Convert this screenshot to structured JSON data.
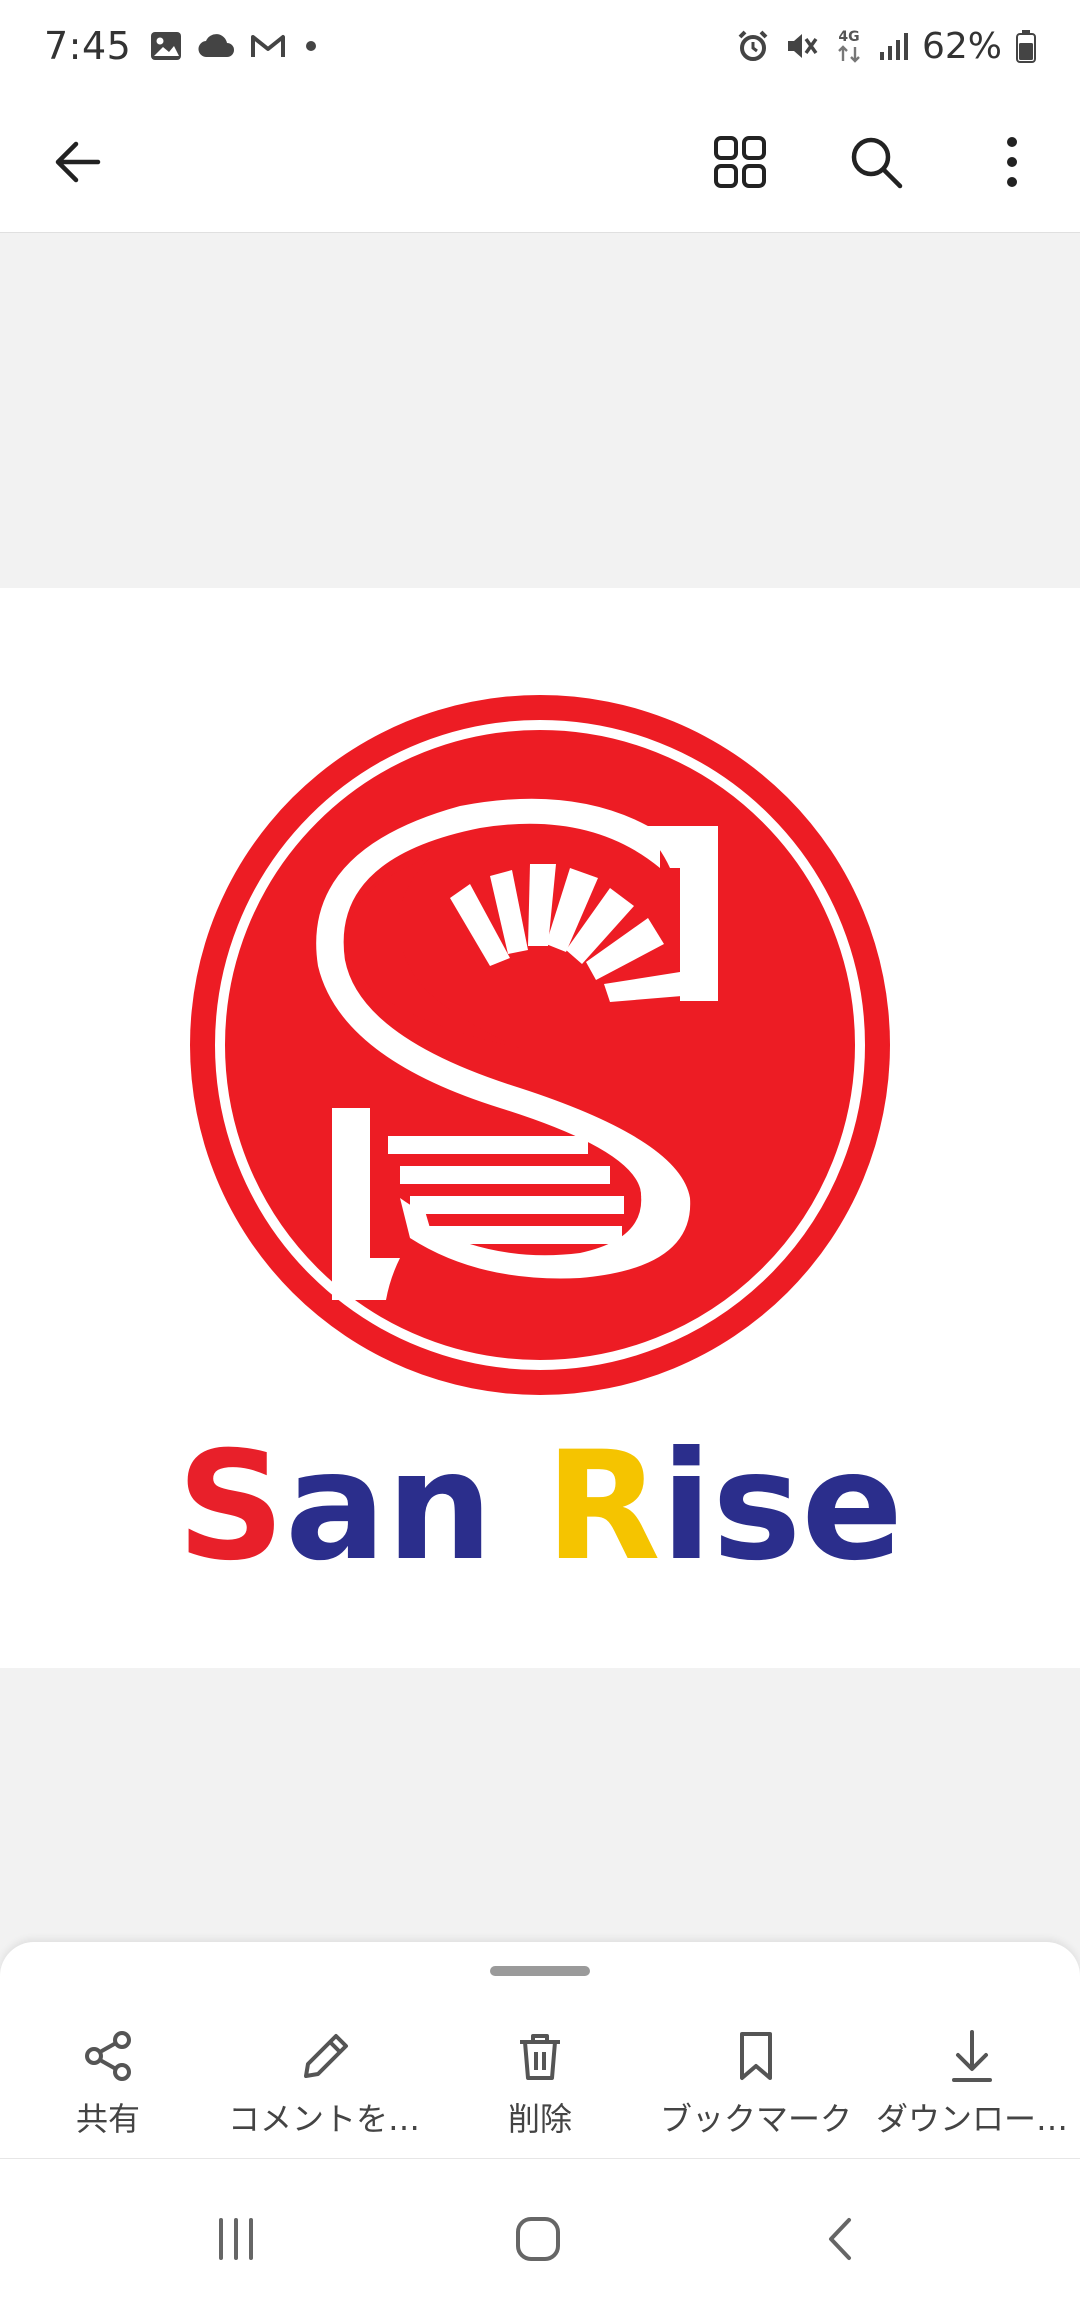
{
  "status_bar": {
    "time": "7:45",
    "battery": "62%",
    "network": "4G",
    "left_icons": [
      "gallery-icon",
      "cloud-icon",
      "gmail-icon",
      "dot-icon"
    ],
    "right_icons": [
      "alarm-icon",
      "mute-icon",
      "network-icon",
      "signal-icon",
      "battery-icon"
    ]
  },
  "app_bar": {
    "icons": [
      "back-arrow-icon",
      "grid-view-icon",
      "search-icon",
      "more-options-icon"
    ]
  },
  "image": {
    "brand_parts": [
      {
        "text": "S",
        "color": "#e8202a"
      },
      {
        "text": "an ",
        "color": "#2b2e8c"
      },
      {
        "text": "R",
        "color": "#f5c400"
      },
      {
        "text": "ise",
        "color": "#2b2e8c"
      }
    ],
    "logo_color": "#ed1c24"
  },
  "actions": [
    {
      "label": "共有",
      "icon": "share-icon"
    },
    {
      "label": "コメントを…",
      "icon": "pencil-icon"
    },
    {
      "label": "削除",
      "icon": "trash-icon"
    },
    {
      "label": "ブックマーク",
      "icon": "bookmark-icon"
    },
    {
      "label": "ダウンロー…",
      "icon": "download-icon"
    }
  ],
  "nav_bar": {
    "icons": [
      "recent-apps-icon",
      "home-icon",
      "back-icon"
    ]
  }
}
